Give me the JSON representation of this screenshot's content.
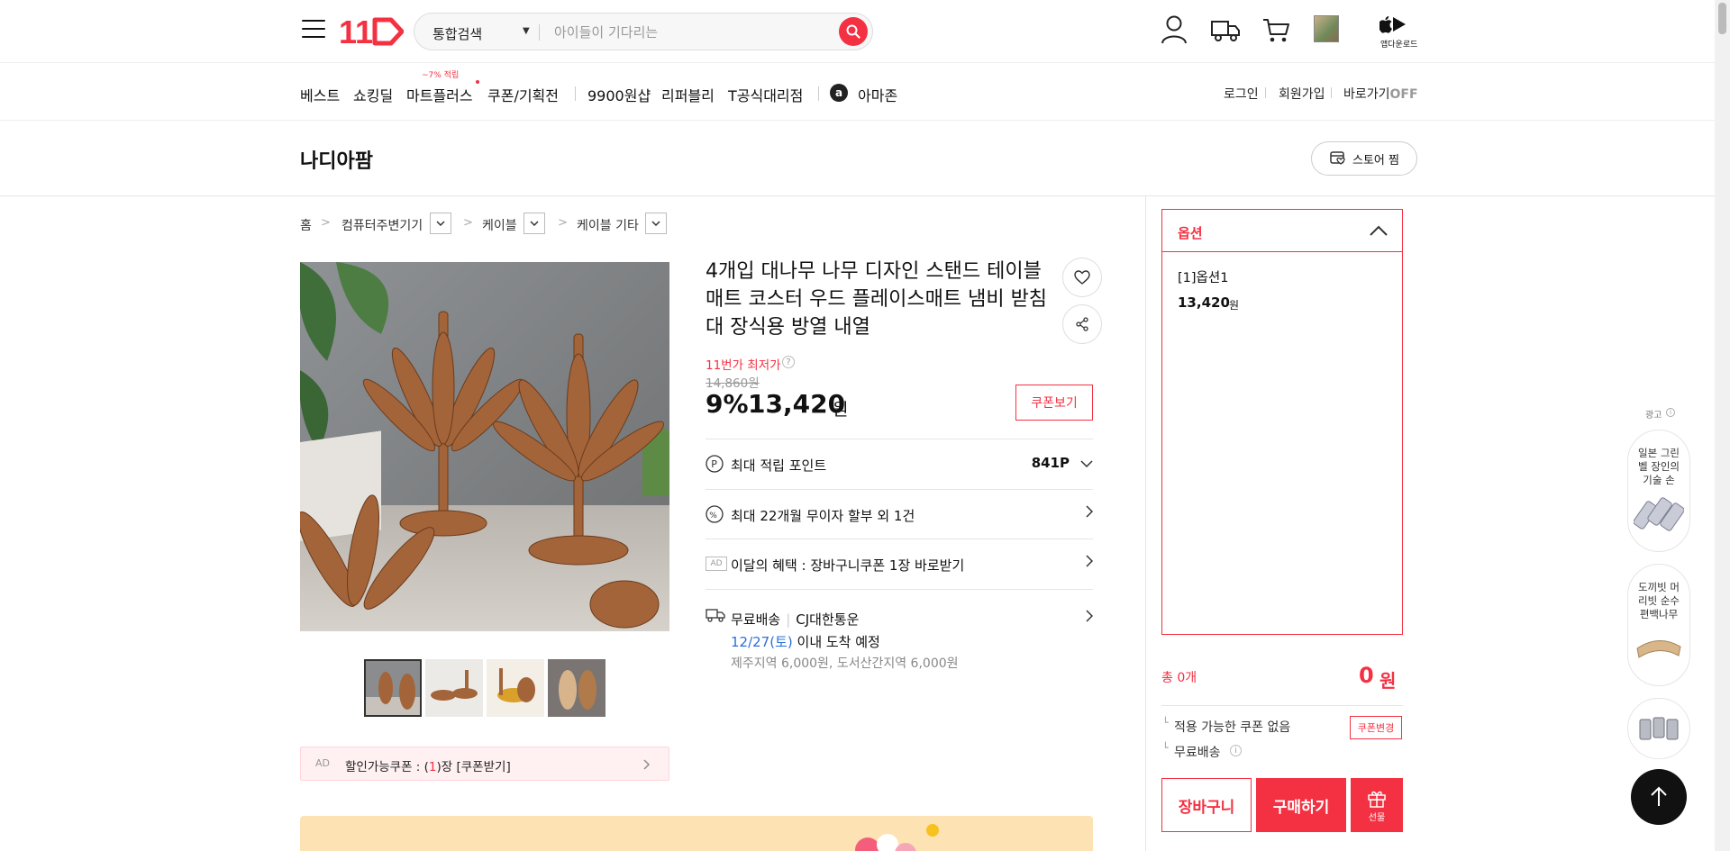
{
  "header": {
    "search_scope": "통합검색",
    "search_placeholder": "아이들이 기다리는",
    "app_download": "앱다운로드",
    "icons": [
      "menu-icon",
      "logo-11st",
      "search-icon",
      "user-icon",
      "truck-icon",
      "cart-icon",
      "recent-item-icon",
      "apple-icon",
      "play-store-icon"
    ]
  },
  "gnb": {
    "items": [
      "베스트",
      "쇼킹딜",
      "마트플러스",
      "쿠폰/기획전",
      "9900원샵",
      "리퍼블리",
      "T공식대리점",
      "아마존"
    ],
    "mart_badge": "~7% 적립",
    "util": [
      "로그인",
      "회원가입",
      "바로가기"
    ],
    "shortcut_state": "OFF"
  },
  "store": {
    "name": "나디아팜",
    "favorite_label": "스토어 찜"
  },
  "breadcrumb": [
    "홈",
    "컴퓨터주변기기",
    "케이블",
    "케이블 기타"
  ],
  "product": {
    "title": "4개입 대나무 나무 디자인 스탠드 테이블 매트 코스터 우드 플레이스매트 냄비 받침대 장식용 방열 내열",
    "lowest_label": "11번가 최저가",
    "original_price": "14,860원",
    "discount": "9%",
    "price": "13,420",
    "price_unit": "원",
    "coupon_view": "쿠폰보기",
    "coupon_strip": {
      "ad": "AD",
      "text_before": "할인가능쿠폰 : (",
      "count": "1",
      "text_after": ")장 [쿠폰받기]"
    }
  },
  "benefits": {
    "points_label": "최대 적립 포인트",
    "points_value": "841P",
    "installment": "최대 22개월 무이자 할부 외 1건",
    "monthly_ad": "AD",
    "monthly": "이달의 혜택 : 장바구니쿠폰 1장 바로받기",
    "delivery_free": "무료배송",
    "courier": "CJ대한통운",
    "arrival_date": "12/27(토)",
    "arrival_text": "이내 도착 예정",
    "extra_fee": "제주지역 6,000원, 도서산간지역 6,000원"
  },
  "options": {
    "header": "옵션",
    "item_name": "[1]옵션1",
    "item_price": "13,420",
    "item_unit": "원",
    "total_label": "총 0개",
    "total_price": "0",
    "total_unit": "원",
    "coupon_none": "적용 가능한 쿠폰 없음",
    "coupon_change": "쿠폰변경",
    "shipping": "무료배송",
    "cart_btn": "장바구니",
    "buy_btn": "구매하기",
    "gift_btn": "선물"
  },
  "ad_rail": {
    "label": "광고",
    "cards": [
      "일본 그린벨 장인의 기술 손",
      "도끼빗 머리빗 순수 편백나무"
    ]
  },
  "colors": {
    "accent": "#f43142",
    "link_blue": "#2a6fdb",
    "banner": "#fde3b3"
  }
}
